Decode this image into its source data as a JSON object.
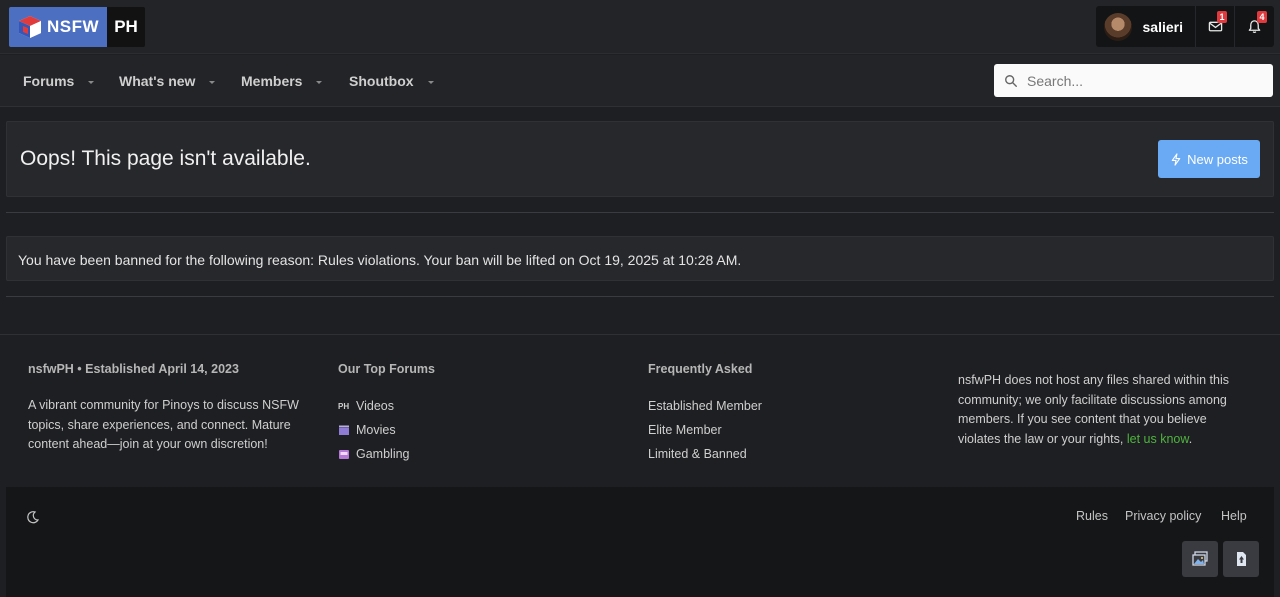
{
  "header": {
    "logo_left": "NSFW",
    "logo_right": "PH",
    "username": "salieri",
    "messages_badge": "1",
    "alerts_badge": "4"
  },
  "nav": {
    "items": [
      {
        "label": "Forums"
      },
      {
        "label": "What's new"
      },
      {
        "label": "Members"
      },
      {
        "label": "Shoutbox"
      }
    ],
    "search_placeholder": "Search..."
  },
  "main": {
    "title": "Oops! This page isn't available.",
    "new_posts_label": "New posts",
    "ban_message": "You have been banned for the following reason: Rules violations. Your ban will be lifted on Oct 19, 2025 at 10:28 AM."
  },
  "footer": {
    "about_heading": "nsfwPH • Established April 14, 2023",
    "about_text": "A vibrant community for Pinoys to discuss NSFW topics, share experiences, and connect. Mature content ahead—join at your own discretion!",
    "top_forums_heading": "Our Top Forums",
    "top_forums": [
      {
        "icon": "ph-icon",
        "prefix": "PH",
        "label": "Videos"
      },
      {
        "icon": "clapperboard-icon",
        "label": "Movies"
      },
      {
        "icon": "slot-machine-icon",
        "label": "Gambling"
      }
    ],
    "faq_heading": "Frequently Asked",
    "faq": [
      {
        "label": "Established Member"
      },
      {
        "label": "Elite Member"
      },
      {
        "label": "Limited & Banned"
      }
    ],
    "disclaimer_text": "nsfwPH does not host any files shared within this community; we only facilitate discussions among members. If you see content that you believe violates the law or your rights,",
    "disclaimer_link": "let us know",
    "disclaimer_end": ".",
    "bottom_links": [
      {
        "label": "Rules"
      },
      {
        "label": "Privacy policy"
      },
      {
        "label": "Help"
      }
    ]
  },
  "colors": {
    "accent": "#6aaaf4",
    "logo_blue": "#4d6fc2",
    "badge_red": "#e0393e",
    "link_green": "#4fb33f"
  }
}
